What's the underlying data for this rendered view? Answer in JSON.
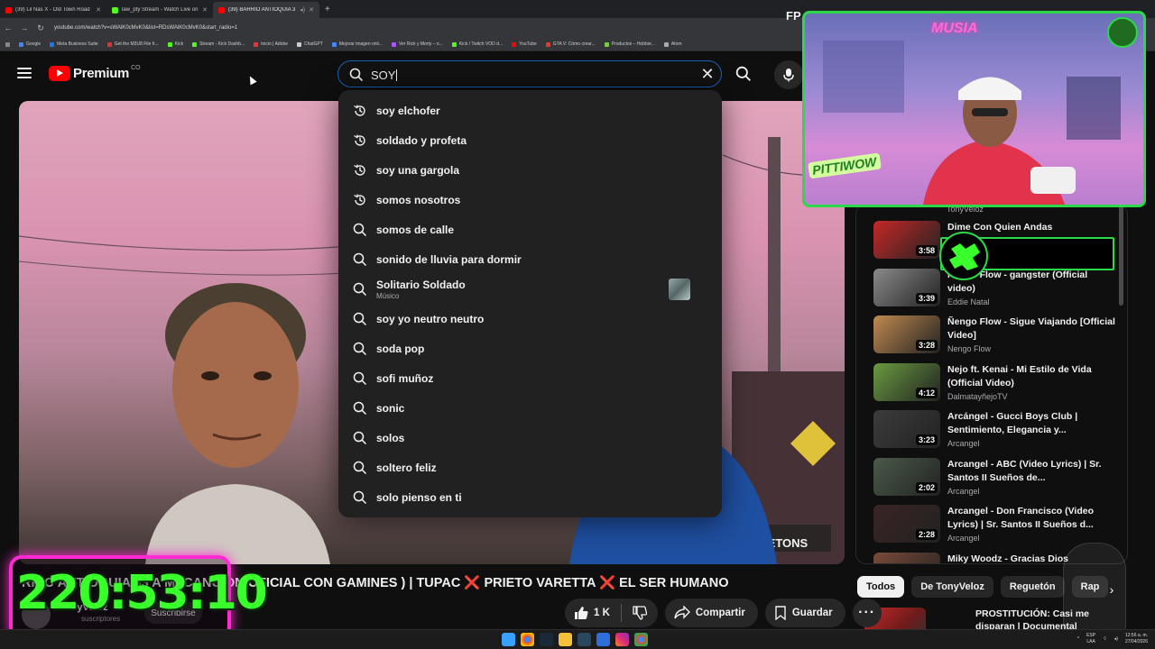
{
  "browser": {
    "tabs": [
      {
        "title": "(39) Lil Nas X - Old Town Road",
        "color": "#ff0000"
      },
      {
        "title": "law_pty Stream - Watch Live on",
        "color": "#53fc18"
      },
      {
        "title": "(39) BARRIO ANTIOQUIA 3",
        "color": "#ff0000"
      }
    ],
    "url": "youtube.com/watch?v=sWAlK0cMvK0&list=RDsWAlK0cMvK0&start_radio=1",
    "bookmarks": [
      {
        "label": "Google",
        "color": "#4285f4"
      },
      {
        "label": "Meta Business Suite",
        "color": "#1877f2"
      },
      {
        "label": "Get the M3U8 File fr...",
        "color": "#d33"
      },
      {
        "label": "Kick",
        "color": "#53fc18"
      },
      {
        "label": "Stream - Kick Dashb...",
        "color": "#53fc18"
      },
      {
        "label": "Inicio | Adobe",
        "color": "#e33"
      },
      {
        "label": "ChatGPT",
        "color": "#ccc"
      },
      {
        "label": "Mejorar imagen onli...",
        "color": "#48f"
      },
      {
        "label": "Ver Rick y Morty – o...",
        "color": "#a5f"
      },
      {
        "label": "Kick / Twitch VOD d...",
        "color": "#53fc18"
      },
      {
        "label": "YouTube",
        "color": "#ff0000"
      },
      {
        "label": "GTA V: Cómo crear...",
        "color": "#e33"
      },
      {
        "label": "Productos – Hobbie...",
        "color": "#7c4"
      },
      {
        "label": "Atom",
        "color": "#aaa"
      }
    ]
  },
  "header": {
    "logo_text": "Premium",
    "country_code": "CO",
    "search_value": "SOY"
  },
  "suggestions": [
    {
      "text": "soy elchofer",
      "type": "history"
    },
    {
      "text": "soldado y profeta",
      "type": "history"
    },
    {
      "text": "soy una gargola",
      "type": "history"
    },
    {
      "text": "somos nosotros",
      "type": "history"
    },
    {
      "text": "somos de calle",
      "type": "search"
    },
    {
      "text": "sonido de lluvia para dormir",
      "type": "search"
    },
    {
      "text": "Solitario Soldado",
      "sub": "Músico",
      "type": "search"
    },
    {
      "text": "soy yo neutro neutro",
      "type": "search"
    },
    {
      "text": "soda pop",
      "type": "search"
    },
    {
      "text": "sofi muñoz",
      "type": "search"
    },
    {
      "text": "sonic",
      "type": "search"
    },
    {
      "text": "solos",
      "type": "search"
    },
    {
      "text": "soltero feliz",
      "type": "search"
    },
    {
      "text": "solo pienso en ti",
      "type": "search"
    }
  ],
  "video": {
    "title_part1": "RRIO ANTIOQUIA 33 A M (CANCION OFICIAL CON GAMINES ) | TUPAC",
    "title_sep": "❌",
    "title_part2": "PRIETO VARETTA",
    "title_part3": "EL SER HUMANO",
    "channel": "TonyVeloz",
    "subs": "suscriptores",
    "subscribe": "Suscribirse",
    "likes": "1 K",
    "share": "Compartir",
    "save": "Guardar"
  },
  "sidebar": {
    "top_channel": "TonyVeloz",
    "items": [
      {
        "title": "Dime Con Quien Andas",
        "channel": "",
        "duration": "3:58",
        "thumb": "#c62828"
      },
      {
        "title": "Ñengo Flow - gangster (Official video)",
        "channel": "Eddie Natal",
        "duration": "3:39",
        "thumb": "#8a8a8a"
      },
      {
        "title": "Ñengo Flow - Sigue Viajando [Official Video]",
        "channel": "Nengo Flow",
        "duration": "3:28",
        "thumb": "#c08a50"
      },
      {
        "title": "Nejo ft. Kenai - Mi Estilo de Vida (Official Video)",
        "channel": "DalmatayñejoTV",
        "duration": "4:12",
        "thumb": "#6a9a40"
      },
      {
        "title": "Arcángel - Gucci Boys Club | Sentimiento, Elegancia y...",
        "channel": "Arcangel",
        "duration": "3:23",
        "thumb": "#3c3c3c"
      },
      {
        "title": "Arcangel - ABC (Video Lyrics) | Sr. Santos II Sueños de...",
        "channel": "Arcangel",
        "duration": "2:02",
        "thumb": "#4a5a4a"
      },
      {
        "title": "Arcangel - Don Francisco (Video Lyrics) | Sr. Santos II Sueños d...",
        "channel": "Arcangel",
        "duration": "2:28",
        "thumb": "#3a2424"
      },
      {
        "title": "Miky Woodz - Gracias Dios",
        "channel": "",
        "duration": "",
        "thumb": "#7a4a3a"
      }
    ],
    "chips": [
      "Todos",
      "De TonyVeloz",
      "Reguetón",
      "Rap"
    ],
    "next_title": "PROSTITUCIÓN: Casi me disparan | Documental"
  },
  "overlay": {
    "timer": "220:53:10",
    "fps_label": "FP",
    "webcam_tag": "PITTIWOW",
    "webcam_neon": "MUSIA"
  },
  "taskbar": {
    "lang1": "ESP",
    "lang2": "LAA",
    "time": "12:56 a. m.",
    "date": "27/04/2026"
  }
}
